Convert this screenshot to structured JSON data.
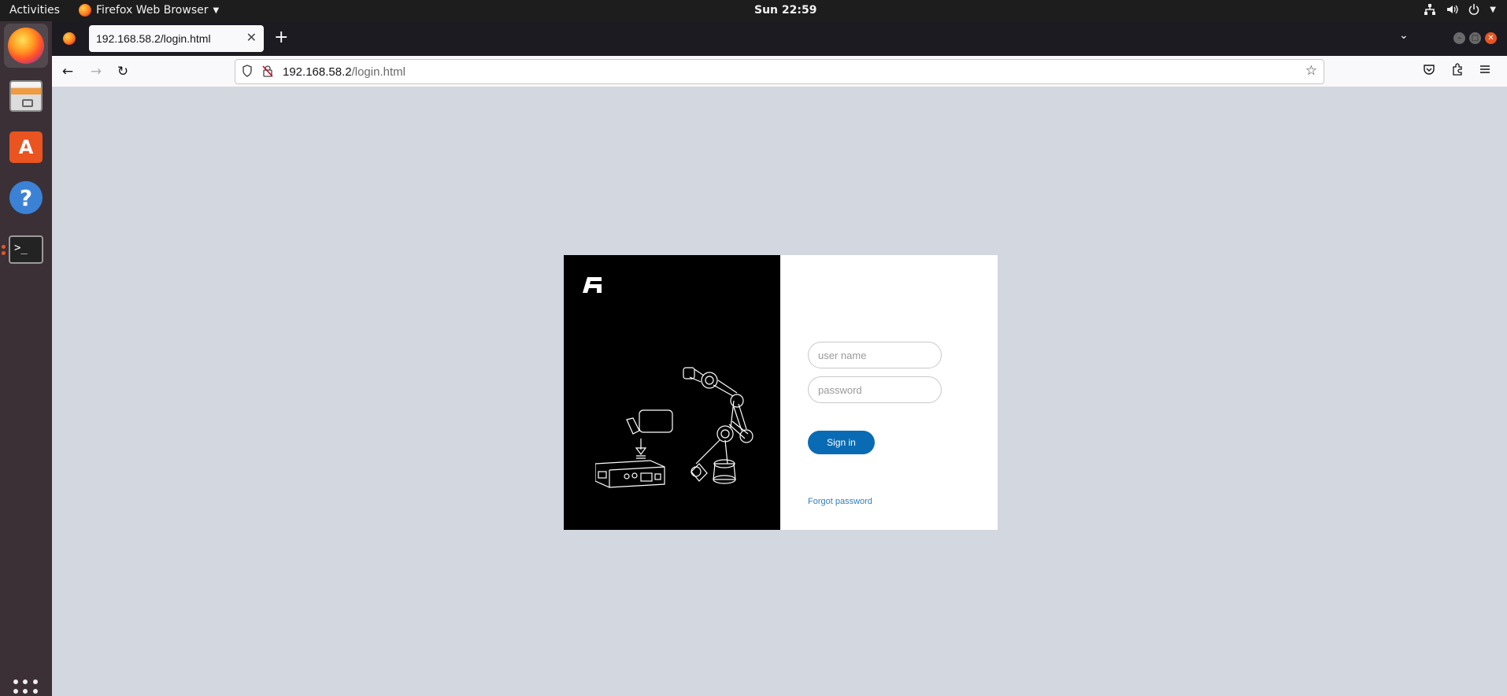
{
  "topbar": {
    "activities": "Activities",
    "app_name": "Firefox Web Browser",
    "clock": "Sun 22:59"
  },
  "dock": {
    "items": [
      {
        "name": "firefox-icon"
      },
      {
        "name": "files-icon"
      },
      {
        "name": "software-store-icon"
      },
      {
        "name": "help-icon"
      },
      {
        "name": "terminal-icon"
      }
    ],
    "terminal_prompt": ">_"
  },
  "browser": {
    "tab_title": "192.168.58.2/login.html",
    "url_host": "192.168.58.2",
    "url_path": "/login.html"
  },
  "login": {
    "username_placeholder": "user name",
    "password_placeholder": "password",
    "signin_label": "Sign in",
    "forgot_label": "Forgot password"
  }
}
